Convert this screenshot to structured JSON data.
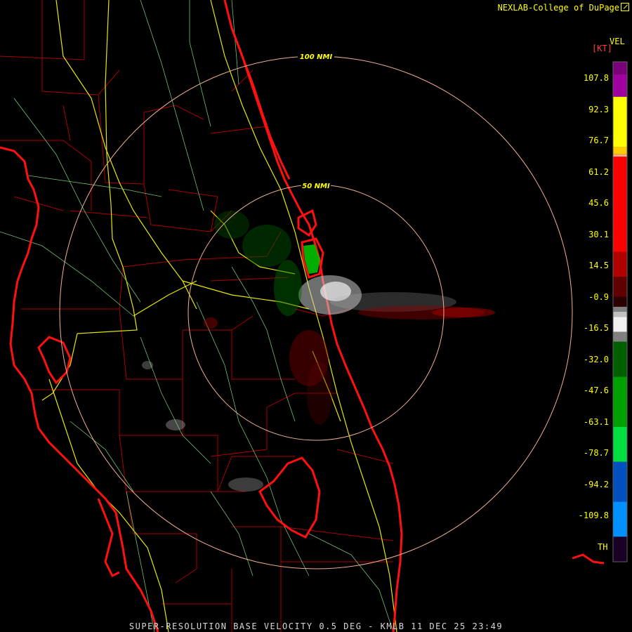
{
  "header": {
    "credit": "NEXLAB-College of DuPage"
  },
  "legend": {
    "product": "VEL",
    "unit": "[KT]",
    "ticks": [
      "107.8",
      "92.3",
      "76.7",
      "61.2",
      "45.6",
      "30.1",
      "14.5",
      "-0.9",
      "-16.5",
      "-32.0",
      "-47.6",
      "-63.1",
      "-78.7",
      "-94.2",
      "-109.8"
    ],
    "threshold_label": "TH",
    "colors": [
      "#7a007a",
      "#a000a0",
      "#ffff00",
      "#ffcc00",
      "#ffaa80",
      "#ff0000",
      "#b00000",
      "#600000",
      "#2a0000",
      "#808080",
      "#c0c0c0",
      "#f0f0f0",
      "#006000",
      "#00a000",
      "#00e040",
      "#0050c0",
      "#0090ff",
      "#1a0026"
    ]
  },
  "map": {
    "range_rings": [
      {
        "label": "100 NMI",
        "range_nmi": 100
      },
      {
        "label": "50 NMI",
        "range_nmi": 50
      }
    ],
    "radar_site": "KMLB"
  },
  "footer": {
    "text": "SUPER-RESOLUTION BASE VELOCITY 0.5 DEG - KMLB 11 DEC 25 23:49"
  }
}
